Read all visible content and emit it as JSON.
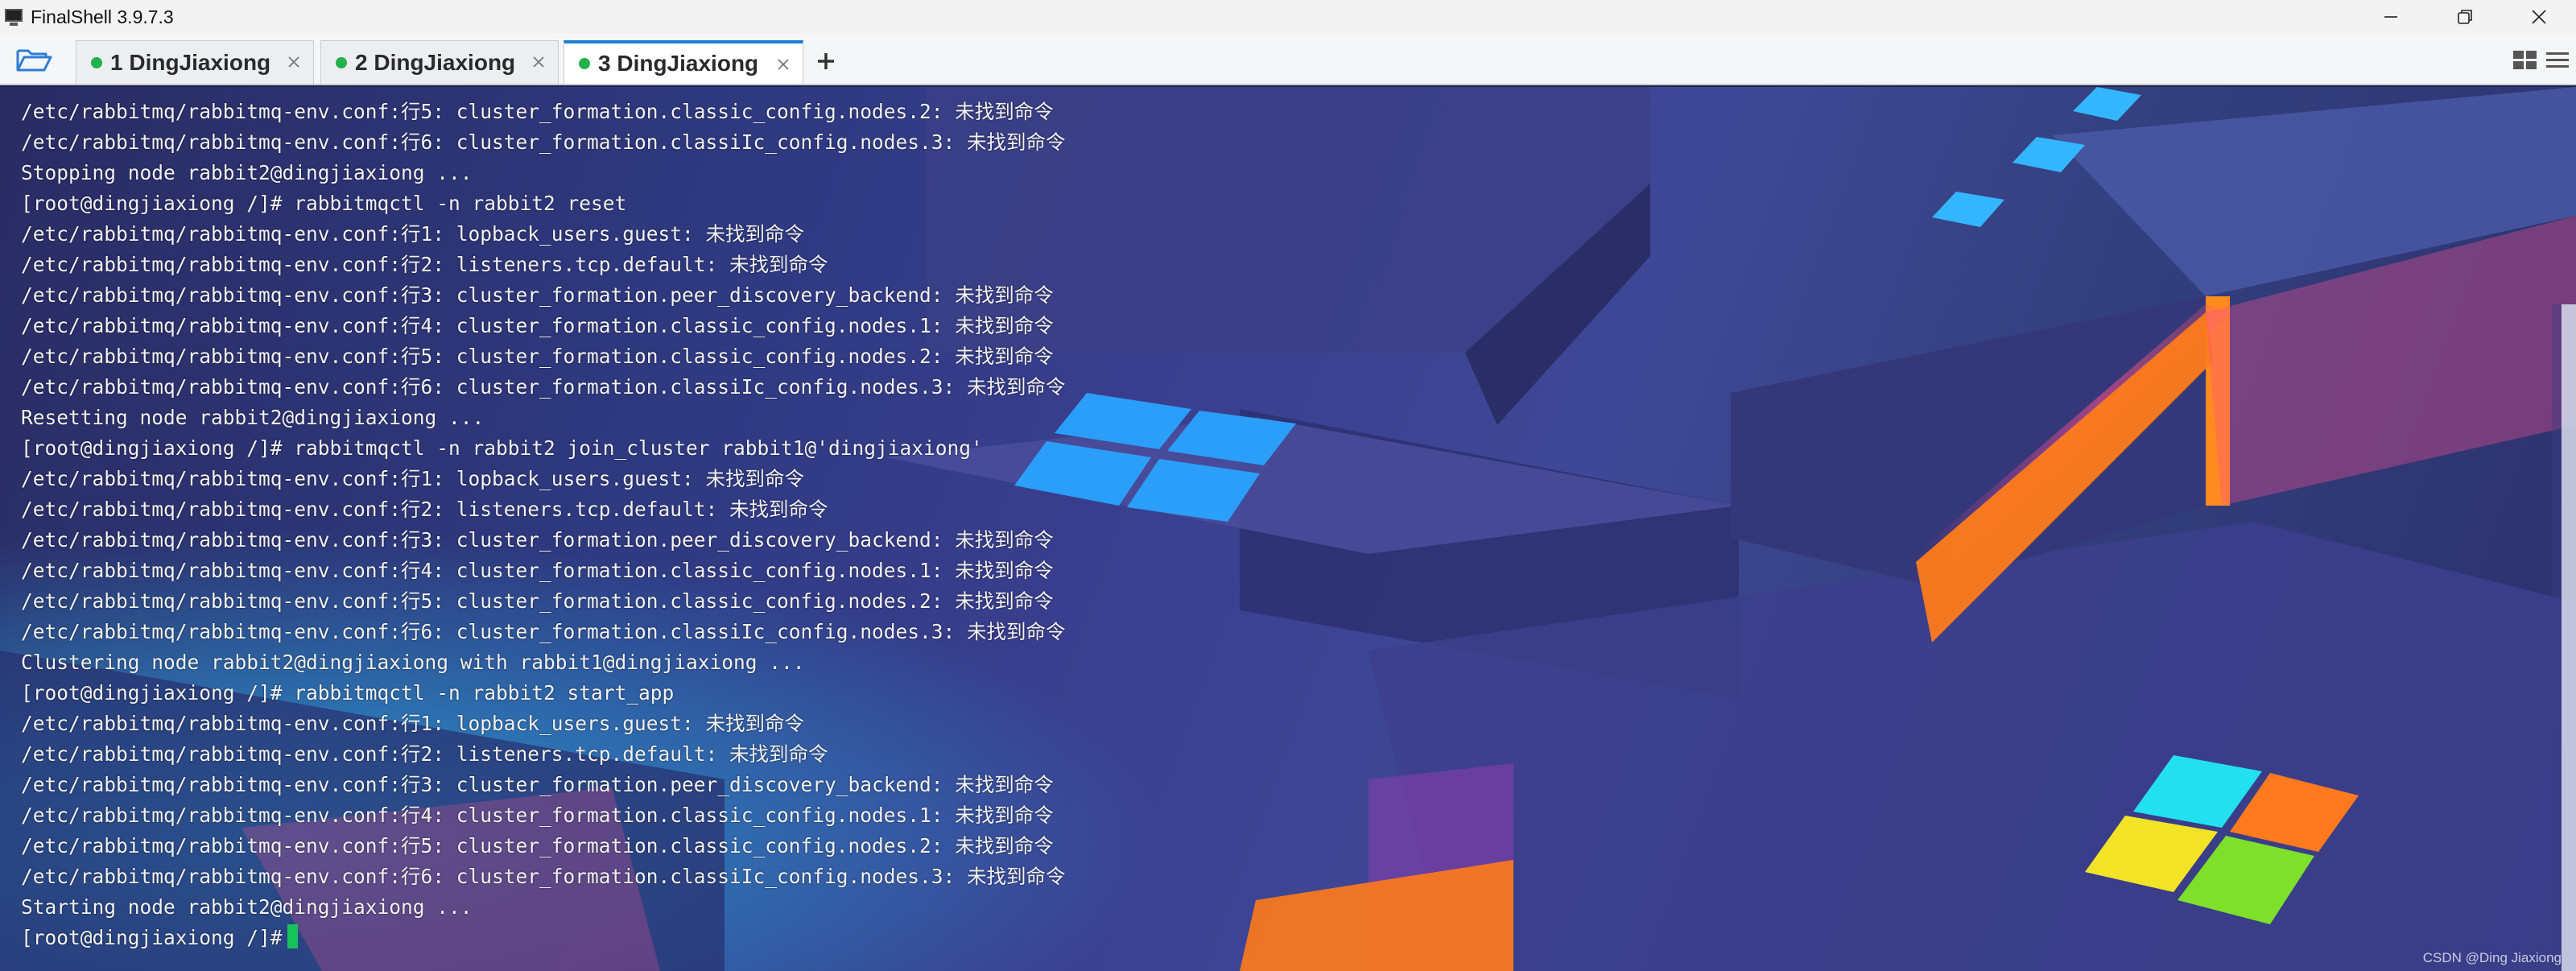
{
  "window": {
    "title": "FinalShell 3.9.7.3"
  },
  "tabs": [
    {
      "label": "1 DingJiaxiong",
      "status_color": "#22b14c",
      "active": false
    },
    {
      "label": "2 DingJiaxiong",
      "status_color": "#22b14c",
      "active": false
    },
    {
      "label": "3 DingJiaxiong",
      "status_color": "#22b14c",
      "active": true
    }
  ],
  "terminal": {
    "lines": [
      "/etc/rabbitmq/rabbitmq-env.conf:行5: cluster_formation.classic_config.nodes.2: 未找到命令",
      "/etc/rabbitmq/rabbitmq-env.conf:行6: cluster_formation.classiIc_config.nodes.3: 未找到命令",
      "Stopping node rabbit2@dingjiaxiong ...",
      "[root@dingjiaxiong /]# rabbitmqctl -n rabbit2 reset",
      "/etc/rabbitmq/rabbitmq-env.conf:行1: lopback_users.guest: 未找到命令",
      "/etc/rabbitmq/rabbitmq-env.conf:行2: listeners.tcp.default: 未找到命令",
      "/etc/rabbitmq/rabbitmq-env.conf:行3: cluster_formation.peer_discovery_backend: 未找到命令",
      "/etc/rabbitmq/rabbitmq-env.conf:行4: cluster_formation.classic_config.nodes.1: 未找到命令",
      "/etc/rabbitmq/rabbitmq-env.conf:行5: cluster_formation.classic_config.nodes.2: 未找到命令",
      "/etc/rabbitmq/rabbitmq-env.conf:行6: cluster_formation.classiIc_config.nodes.3: 未找到命令",
      "Resetting node rabbit2@dingjiaxiong ...",
      "[root@dingjiaxiong /]# rabbitmqctl -n rabbit2 join_cluster rabbit1@'dingjiaxiong'",
      "/etc/rabbitmq/rabbitmq-env.conf:行1: lopback_users.guest: 未找到命令",
      "/etc/rabbitmq/rabbitmq-env.conf:行2: listeners.tcp.default: 未找到命令",
      "/etc/rabbitmq/rabbitmq-env.conf:行3: cluster_formation.peer_discovery_backend: 未找到命令",
      "/etc/rabbitmq/rabbitmq-env.conf:行4: cluster_formation.classic_config.nodes.1: 未找到命令",
      "/etc/rabbitmq/rabbitmq-env.conf:行5: cluster_formation.classic_config.nodes.2: 未找到命令",
      "/etc/rabbitmq/rabbitmq-env.conf:行6: cluster_formation.classiIc_config.nodes.3: 未找到命令",
      "Clustering node rabbit2@dingjiaxiong with rabbit1@dingjiaxiong ...",
      "[root@dingjiaxiong /]# rabbitmqctl -n rabbit2 start_app",
      "/etc/rabbitmq/rabbitmq-env.conf:行1: lopback_users.guest: 未找到命令",
      "/etc/rabbitmq/rabbitmq-env.conf:行2: listeners.tcp.default: 未找到命令",
      "/etc/rabbitmq/rabbitmq-env.conf:行3: cluster_formation.peer_discovery_backend: 未找到命令",
      "/etc/rabbitmq/rabbitmq-env.conf:行4: cluster_formation.classic_config.nodes.1: 未找到命令",
      "/etc/rabbitmq/rabbitmq-env.conf:行5: cluster_formation.classic_config.nodes.2: 未找到命令",
      "/etc/rabbitmq/rabbitmq-env.conf:行6: cluster_formation.classiIc_config.nodes.3: 未找到命令",
      "Starting node rabbit2@dingjiaxiong ..."
    ],
    "prompt": "[root@dingjiaxiong /]#",
    "cursor_color": "#16c35a"
  },
  "watermark": "CSDN @Ding Jiaxiong",
  "icons": {
    "open_folder": "folder-open-icon",
    "add_tab": "plus-icon",
    "grid_view": "grid-view-icon",
    "list_view": "list-view-icon",
    "minimize": "minimize-icon",
    "maximize": "maximize-icon",
    "close": "close-icon"
  }
}
